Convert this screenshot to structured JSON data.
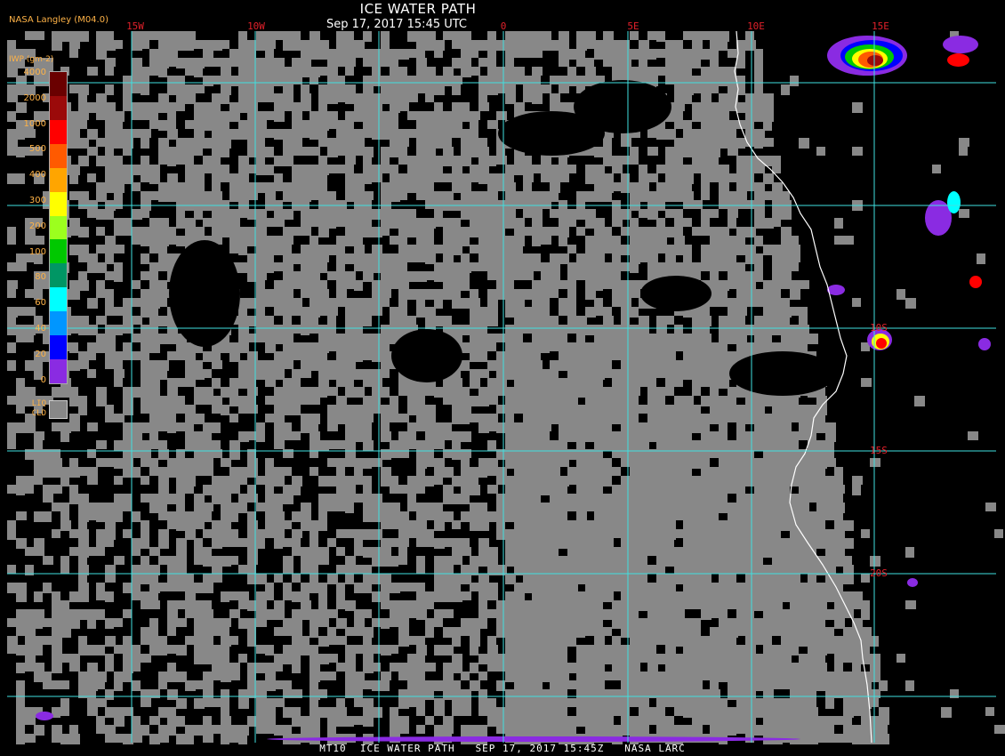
{
  "header": {
    "title": "ICE WATER PATH",
    "datetime": "Sep 17, 2017 15:45 UTC",
    "source": "NASA Langley (M04.0)"
  },
  "footer": {
    "caption": "MT10  ICE WATER PATH   SEP 17, 2017 15:45Z   NASA LARC"
  },
  "legend": {
    "title": "IWP (gm-2)",
    "liquid_label_line1": "LIQ",
    "liquid_label_line2": "CLD",
    "liquid_color": "#888888",
    "ticks": [
      {
        "label": "4000",
        "color": "#6a0000"
      },
      {
        "label": "2000",
        "color": "#9b0a0a"
      },
      {
        "label": "1000",
        "color": "#ff0000"
      },
      {
        "label": "500",
        "color": "#ff5a00"
      },
      {
        "label": "400",
        "color": "#ffa500"
      },
      {
        "label": "300",
        "color": "#ffff00"
      },
      {
        "label": "200",
        "color": "#9cff1e"
      },
      {
        "label": "100",
        "color": "#00c800"
      },
      {
        "label": "80",
        "color": "#009664"
      },
      {
        "label": "60",
        "color": "#00ffff"
      },
      {
        "label": "40",
        "color": "#0096ff"
      },
      {
        "label": "20",
        "color": "#0000ff"
      },
      {
        "label": "0",
        "color": "#8a2be2"
      }
    ]
  },
  "grid": {
    "color": "#40e0e0",
    "longitude_labels": [
      "15W",
      "10W",
      "0",
      "5E",
      "10E",
      "15E"
    ],
    "latitude_labels": [
      "10S",
      "15S",
      "20S"
    ]
  },
  "colors": {
    "background": "#000000",
    "liquid_cloud": "#888888",
    "coastline": "#ffffff",
    "label_red": "#e0202a",
    "label_orange": "#ffb347"
  }
}
